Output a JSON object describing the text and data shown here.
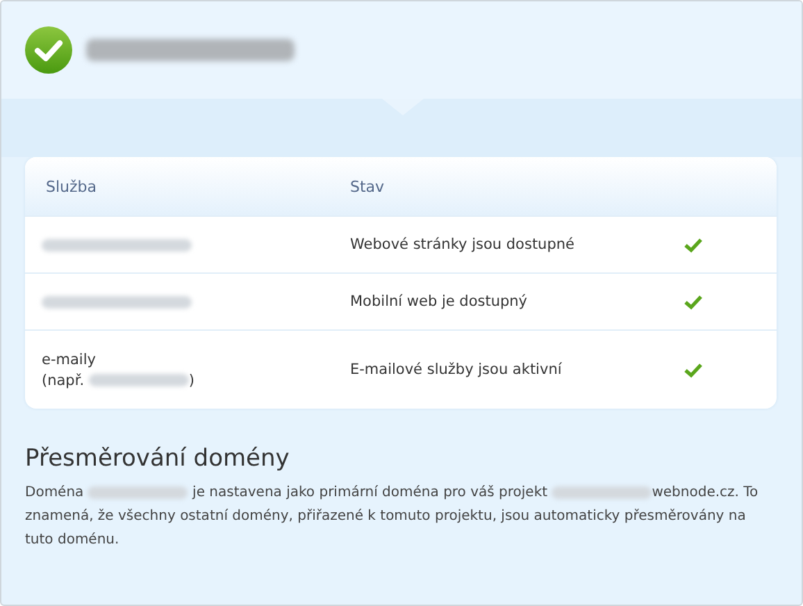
{
  "header": {
    "status_ok": true,
    "domain": [
      {
        "kind": "redacted"
      }
    ]
  },
  "table": {
    "columns": [
      "Služba",
      "Stav"
    ],
    "rows": [
      {
        "service": [
          [
            {
              "kind": "redacted"
            }
          ]
        ],
        "status": "Webové stránky jsou dostupné",
        "ok": true
      },
      {
        "service": [
          [
            {
              "kind": "redacted"
            }
          ]
        ],
        "status": "Mobilní web je dostupný",
        "ok": true
      },
      {
        "service": [
          [
            {
              "kind": "text",
              "text": "e-maily"
            }
          ],
          [
            {
              "kind": "text",
              "text": "(např. "
            },
            {
              "kind": "redacted"
            },
            {
              "kind": "text",
              "text": ")"
            }
          ]
        ],
        "status": "E-mailové služby jsou aktivní",
        "ok": true
      }
    ]
  },
  "redirect": {
    "title": "Přesměrování domény",
    "paragraph": [
      {
        "kind": "text",
        "text": "Doména "
      },
      {
        "kind": "redacted"
      },
      {
        "kind": "text",
        "text": " je nastavena jako primární doména pro váš projekt "
      },
      {
        "kind": "redacted"
      },
      {
        "kind": "text",
        "text": "webnode.cz. To znamená, že všechny ostatní domény, přiřazené k tomuto projektu, jsou automaticky přesměrovány na tuto doménu."
      }
    ]
  }
}
